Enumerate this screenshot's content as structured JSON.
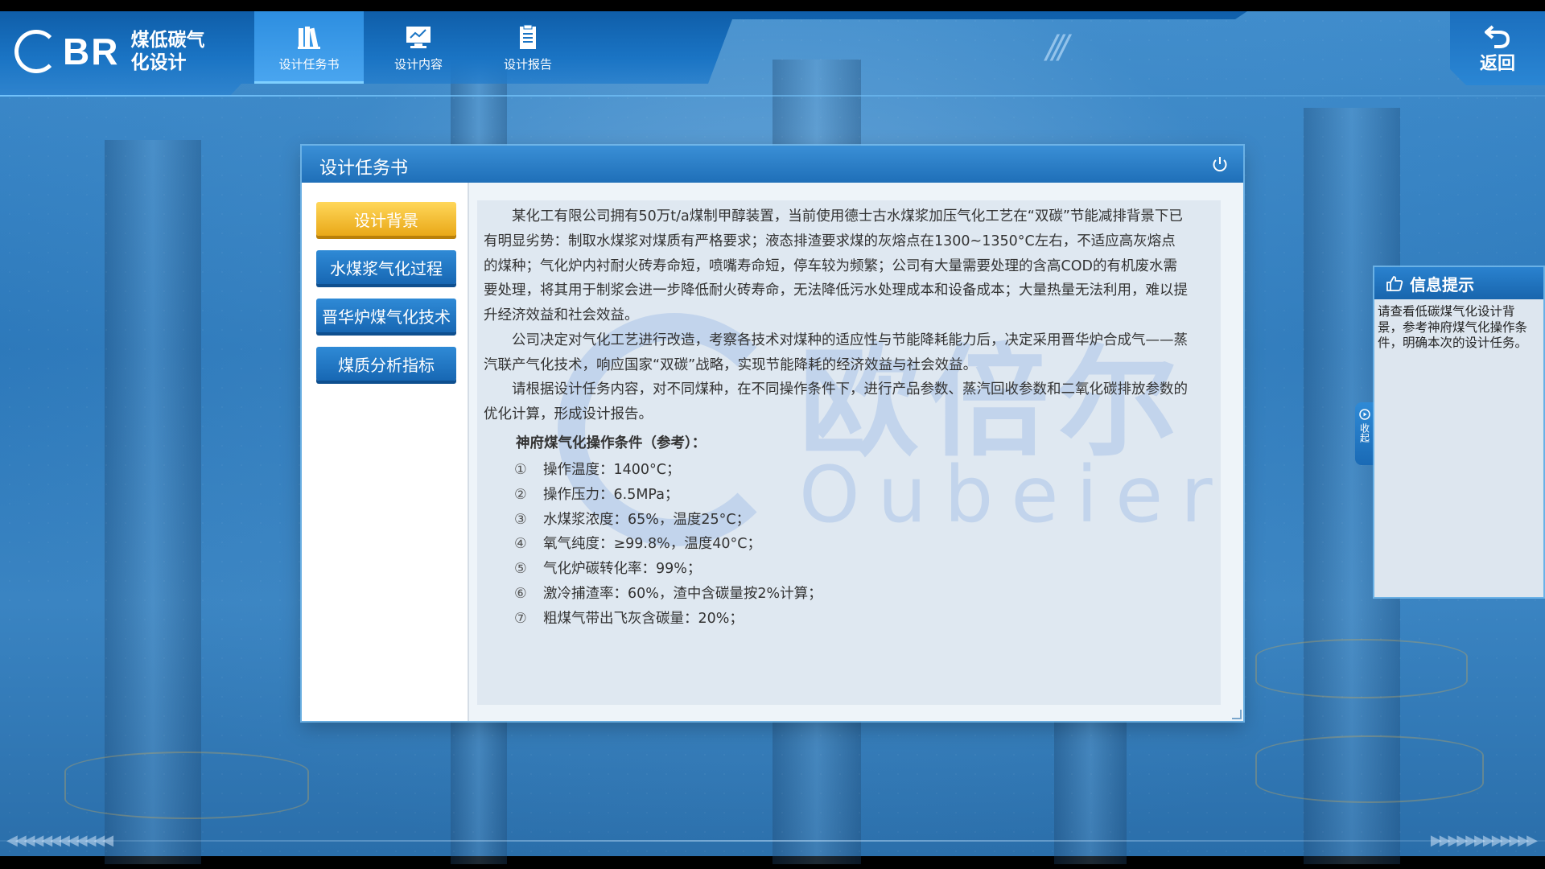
{
  "header": {
    "logo_text": "BR",
    "app_title": "煤低碳气化设计",
    "nav": [
      {
        "label": "设计任务书",
        "icon": "books-icon",
        "active": true
      },
      {
        "label": "设计内容",
        "icon": "monitor-icon",
        "active": false
      },
      {
        "label": "设计报告",
        "icon": "clipboard-icon",
        "active": false
      }
    ],
    "back_label": "返回"
  },
  "dialog": {
    "title": "设计任务书",
    "sidebar": [
      {
        "label": "设计背景",
        "active": true
      },
      {
        "label": "水煤浆气化过程",
        "active": false
      },
      {
        "label": "晋华炉煤气化技术",
        "active": false
      },
      {
        "label": "煤质分析指标",
        "active": false
      }
    ],
    "paragraphs": [
      "某化工有限公司拥有50万t/a煤制甲醇装置，当前使用德士古水煤浆加压气化工艺在“双碳”节能减排背景下已有明显劣势：制取水煤浆对煤质有严格要求；液态排渣要求煤的灰熔点在1300~1350°C左右，不适应高灰熔点的煤种；气化炉内衬耐火砖寿命短，喷嘴寿命短，停车较为频繁；公司有大量需要处理的含高COD的有机废水需要处理，将其用于制浆会进一步降低耐火砖寿命，无法降低污水处理成本和设备成本；大量热量无法利用，难以提升经济效益和社会效益。",
      "公司决定对气化工艺进行改造，考察各技术对煤种的适应性与节能降耗能力后，决定采用晋华炉合成气——蒸汽联产气化技术，响应国家“双碳”战略，实现节能降耗的经济效益与社会效益。",
      "请根据设计任务内容，对不同煤种，在不同操作条件下，进行产品参数、蒸汽回收参数和二氧化碳排放参数的优化计算，形成设计报告。"
    ],
    "conditions_title": "神府煤气化操作条件（参考）：",
    "conditions": [
      {
        "num": "①",
        "text": "操作温度：1400°C；"
      },
      {
        "num": "②",
        "text": "操作压力：6.5MPa；"
      },
      {
        "num": "③",
        "text": "水煤浆浓度：65%，温度25°C；"
      },
      {
        "num": "④",
        "text": "氧气纯度：≥99.8%，温度40°C；"
      },
      {
        "num": "⑤",
        "text": "气化炉碳转化率：99%；"
      },
      {
        "num": "⑥",
        "text": "激冷捕渣率：60%，渣中含碳量按2%计算；"
      },
      {
        "num": "⑦",
        "text": "粗煤气带出飞灰含碳量：20%；"
      }
    ],
    "watermark_cn": "欧倍尔",
    "watermark_en": "Oubeier"
  },
  "info_panel": {
    "title": "信息提示",
    "body": "请查看低碳煤气化设计背景，参考神府煤气化操作条件，明确本次的设计任务。",
    "collapse_label": "收起"
  },
  "colors": {
    "accent_blue": "#1f6fb8",
    "active_yellow": "#e9a818",
    "panel_bg": "#dfe8f1"
  }
}
